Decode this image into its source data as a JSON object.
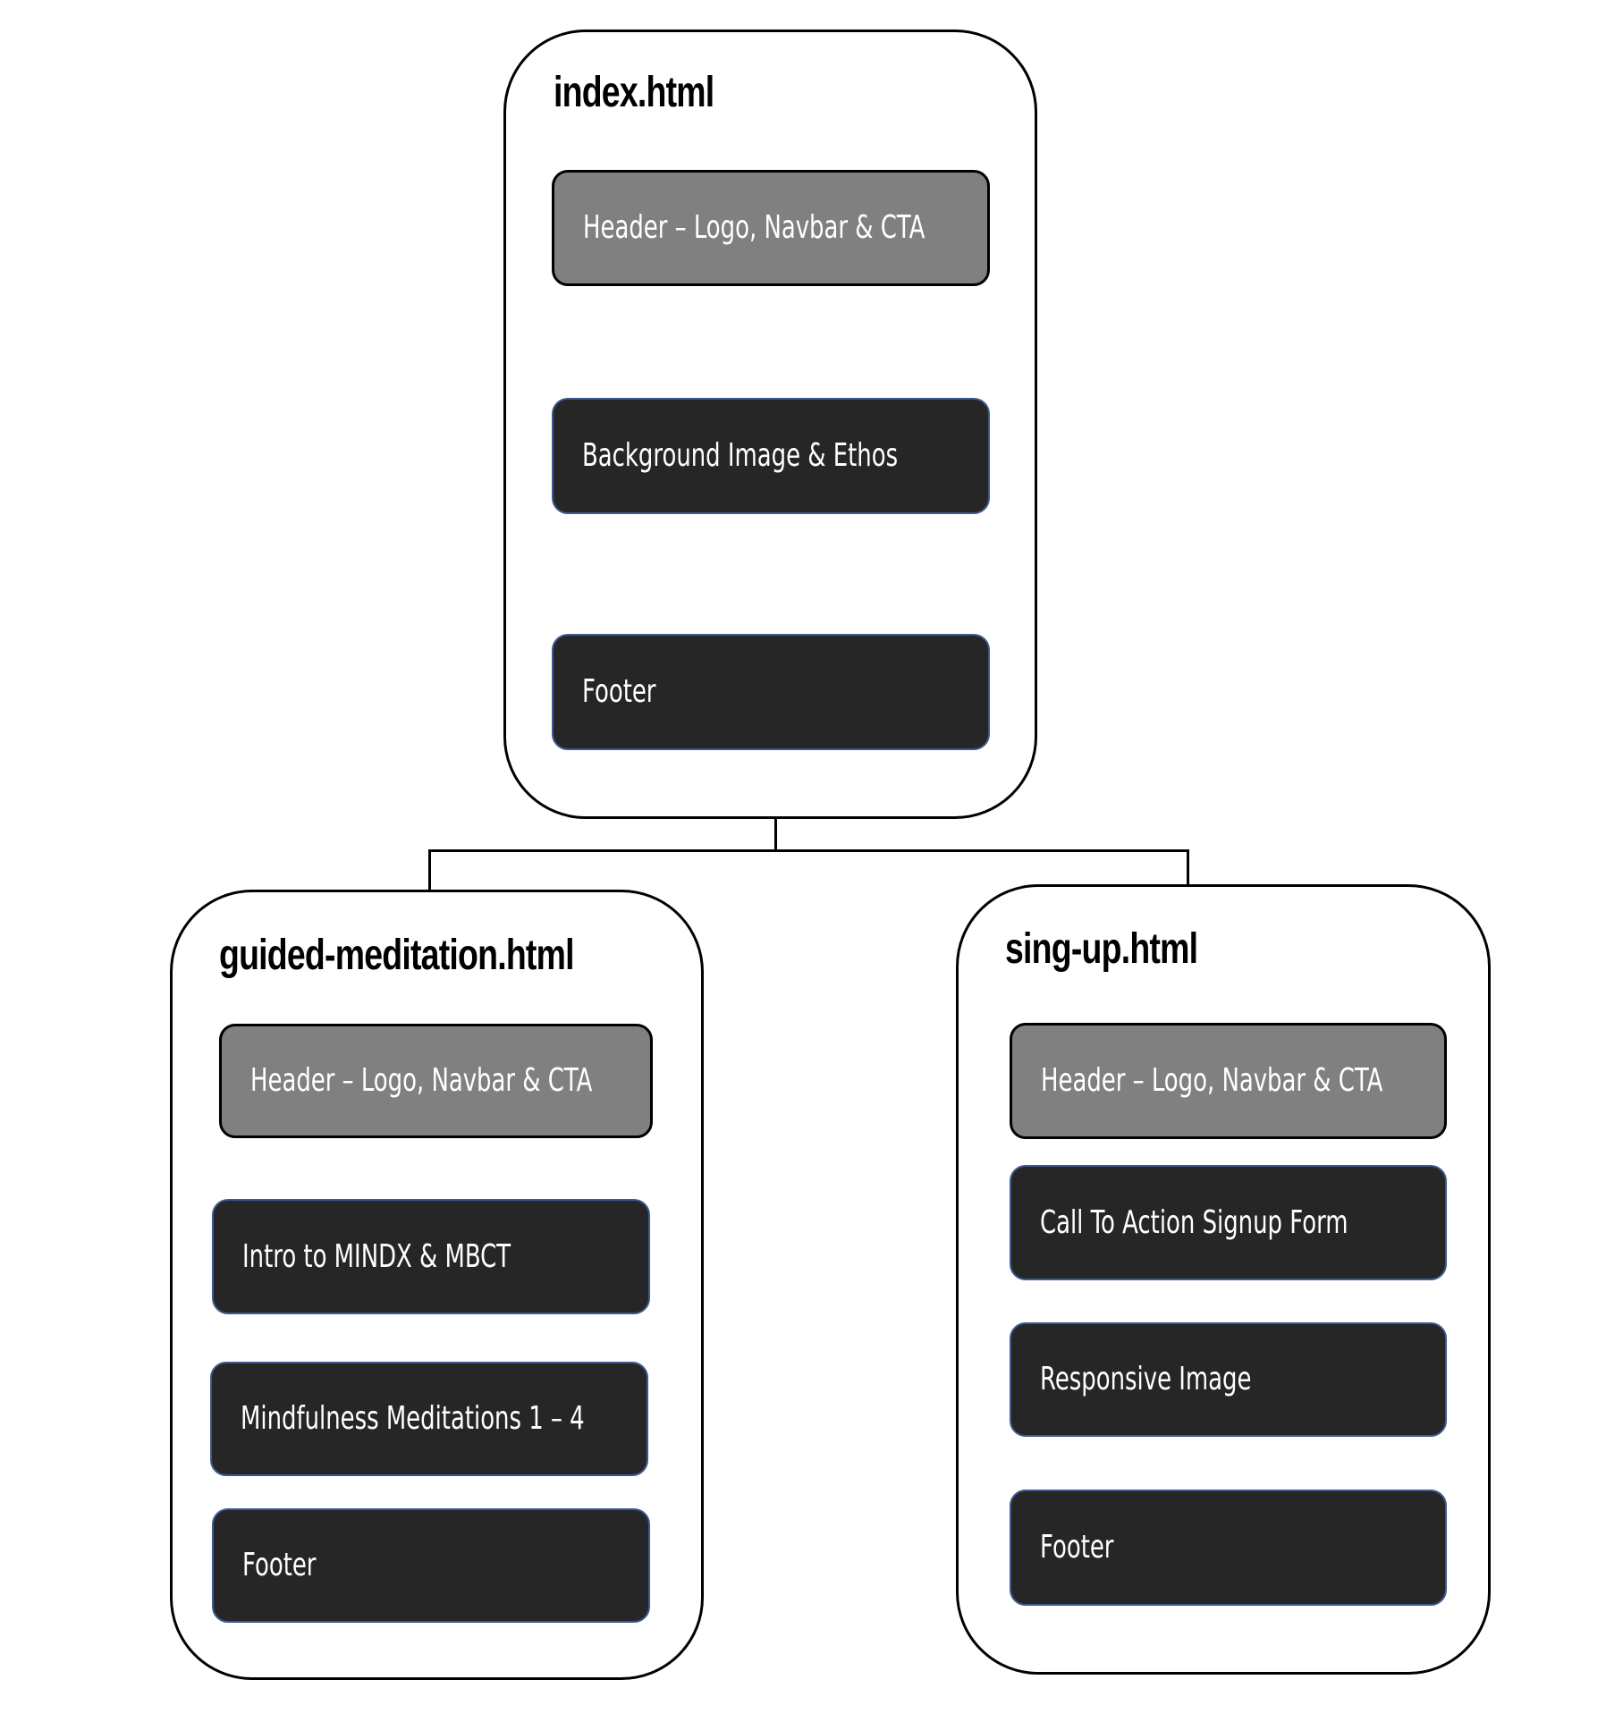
{
  "diagram": {
    "type": "sitemap",
    "root": {
      "title": "index.html",
      "sections": [
        {
          "label": "Header – Logo, Navbar & CTA",
          "style": "light"
        },
        {
          "label": "Background Image & Ethos",
          "style": "dark"
        },
        {
          "label": "Footer",
          "style": "dark"
        }
      ]
    },
    "children": [
      {
        "title": "guided-meditation.html",
        "sections": [
          {
            "label": "Header – Logo, Navbar & CTA",
            "style": "light"
          },
          {
            "label": "Intro to MINDX & MBCT",
            "style": "dark"
          },
          {
            "label": "Mindfulness Meditations 1 – 4",
            "style": "dark"
          },
          {
            "label": "Footer",
            "style": "dark"
          }
        ]
      },
      {
        "title": "sing-up.html",
        "sections": [
          {
            "label": "Header – Logo, Navbar & CTA",
            "style": "light"
          },
          {
            "label": "Call To Action Signup Form",
            "style": "dark"
          },
          {
            "label": "Responsive Image",
            "style": "dark"
          },
          {
            "label": "Footer",
            "style": "dark"
          }
        ]
      }
    ],
    "colors": {
      "header_fill": "#808080",
      "section_fill": "#262626",
      "section_border": "#3b5a92",
      "page_border": "#000000",
      "label_text": "#ffffff"
    }
  }
}
